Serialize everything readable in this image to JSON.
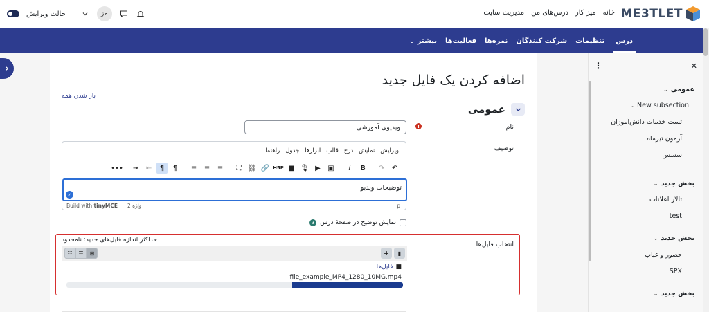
{
  "header": {
    "logo_text": "ME3TLET",
    "nav": [
      "خانه",
      "میز کار",
      "درس‌های من",
      "مدیریت سایت"
    ],
    "avatar_initials": "مز",
    "edit_mode_label": "حالت ویرایش"
  },
  "secondary_nav": {
    "items": [
      "درس",
      "تنظیمات",
      "شرکت کنندگان",
      "نمره‌ها",
      "فعالیت‌ها",
      "بیشتر ⌄"
    ],
    "active": "درس"
  },
  "drawer": {
    "close_glyph": "✕",
    "kebab_glyph": "⋮",
    "items": [
      {
        "label": "عمومی",
        "kind": "section"
      },
      {
        "label": "New subsection",
        "kind": "sub"
      },
      {
        "label": "تست خدمات دانش‌آموزان",
        "kind": "item"
      },
      {
        "label": "آزمون تیرماه",
        "kind": "item"
      },
      {
        "label": "سسس",
        "kind": "item"
      },
      {
        "label": "بخش جدید",
        "kind": "section"
      },
      {
        "label": "تالار اعلانات",
        "kind": "item"
      },
      {
        "label": "test",
        "kind": "item"
      },
      {
        "label": "بخش جدید",
        "kind": "section"
      },
      {
        "label": "حضور و غیاب",
        "kind": "item"
      },
      {
        "label": "SPX",
        "kind": "item"
      },
      {
        "label": "بخش جدید",
        "kind": "section"
      }
    ]
  },
  "page": {
    "title": "اضافه کردن یک فایل جدید",
    "expand_all": "باز شدن همه",
    "section_title": "عمومی",
    "name_label": "نام",
    "name_value": "ویدیوی آموزشی",
    "description_label": "توصیف",
    "editor": {
      "menu": [
        "ویرایش",
        "نمایش",
        "درج",
        "قالب",
        "ابزارها",
        "جدول",
        "راهنما"
      ],
      "content": "توضیحات ویدیو",
      "word_count": "2 واژه",
      "build_with": "Build with",
      "tinymce": "tinyMCE",
      "path": "p"
    },
    "show_description_label": "نمایش توضیح در صفحهٔ درس",
    "files_label": "انتخاب فایل‌ها",
    "max_size": "حداکثر اندازه فایل‌های جدید: نامحدود",
    "files_folder": "فایل‌ها",
    "file_name": "file_example_MP4_1280_10MG.mp4",
    "upload_progress": 0.33
  },
  "colors": {
    "brand": "#2d3c8f",
    "required": "#ca3120",
    "highlight_border": "#d62f2f",
    "progress": "#1a3b8f"
  }
}
